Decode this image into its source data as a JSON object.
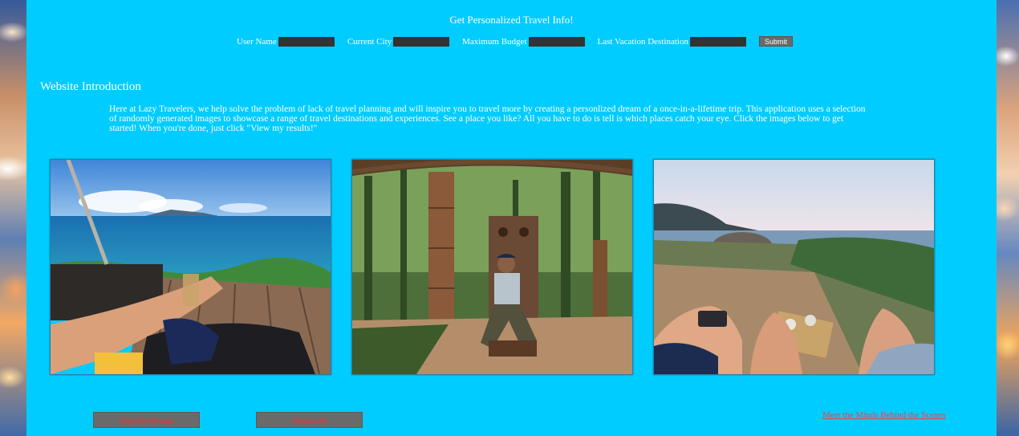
{
  "header": {
    "title": "Get Personalized Travel Info!",
    "fields": [
      {
        "label": "User Name",
        "value": ""
      },
      {
        "label": "Current City",
        "value": ""
      },
      {
        "label": "Maximum Budget",
        "value": ""
      },
      {
        "label": "Last Vacation Destination",
        "value": ""
      }
    ],
    "submit_label": "Submit"
  },
  "intro": {
    "heading": "Website Introduction",
    "text": "Here at Lazy Travelers, we help solve the problem of lack of travel planning and will inspire you to travel more by creating a personlized dream of a once-in-a-lifetime trip. This application uses a selection of randomly generated images to showcase a range of travel destinations and experiences. See a place you like? All you have to do is tell is which places catch your eye. Click the images below to get started! When you're done, just click \"View my results!\""
  },
  "gallery": [
    {
      "subject": "seaside-deck-photo"
    },
    {
      "subject": "forest-wood-carving-photo"
    },
    {
      "subject": "coastal-hillside-photo"
    }
  ],
  "actions": {
    "view_results_label": "View My Results",
    "reset_label": "Reset it All",
    "meet_link_label": "Meet the Minds Behind the Scenes"
  },
  "colors": {
    "panel": "#00ccff",
    "button": "#6a6a6a",
    "button_text": "#ff2d2d",
    "link": "#ff3b3b"
  }
}
